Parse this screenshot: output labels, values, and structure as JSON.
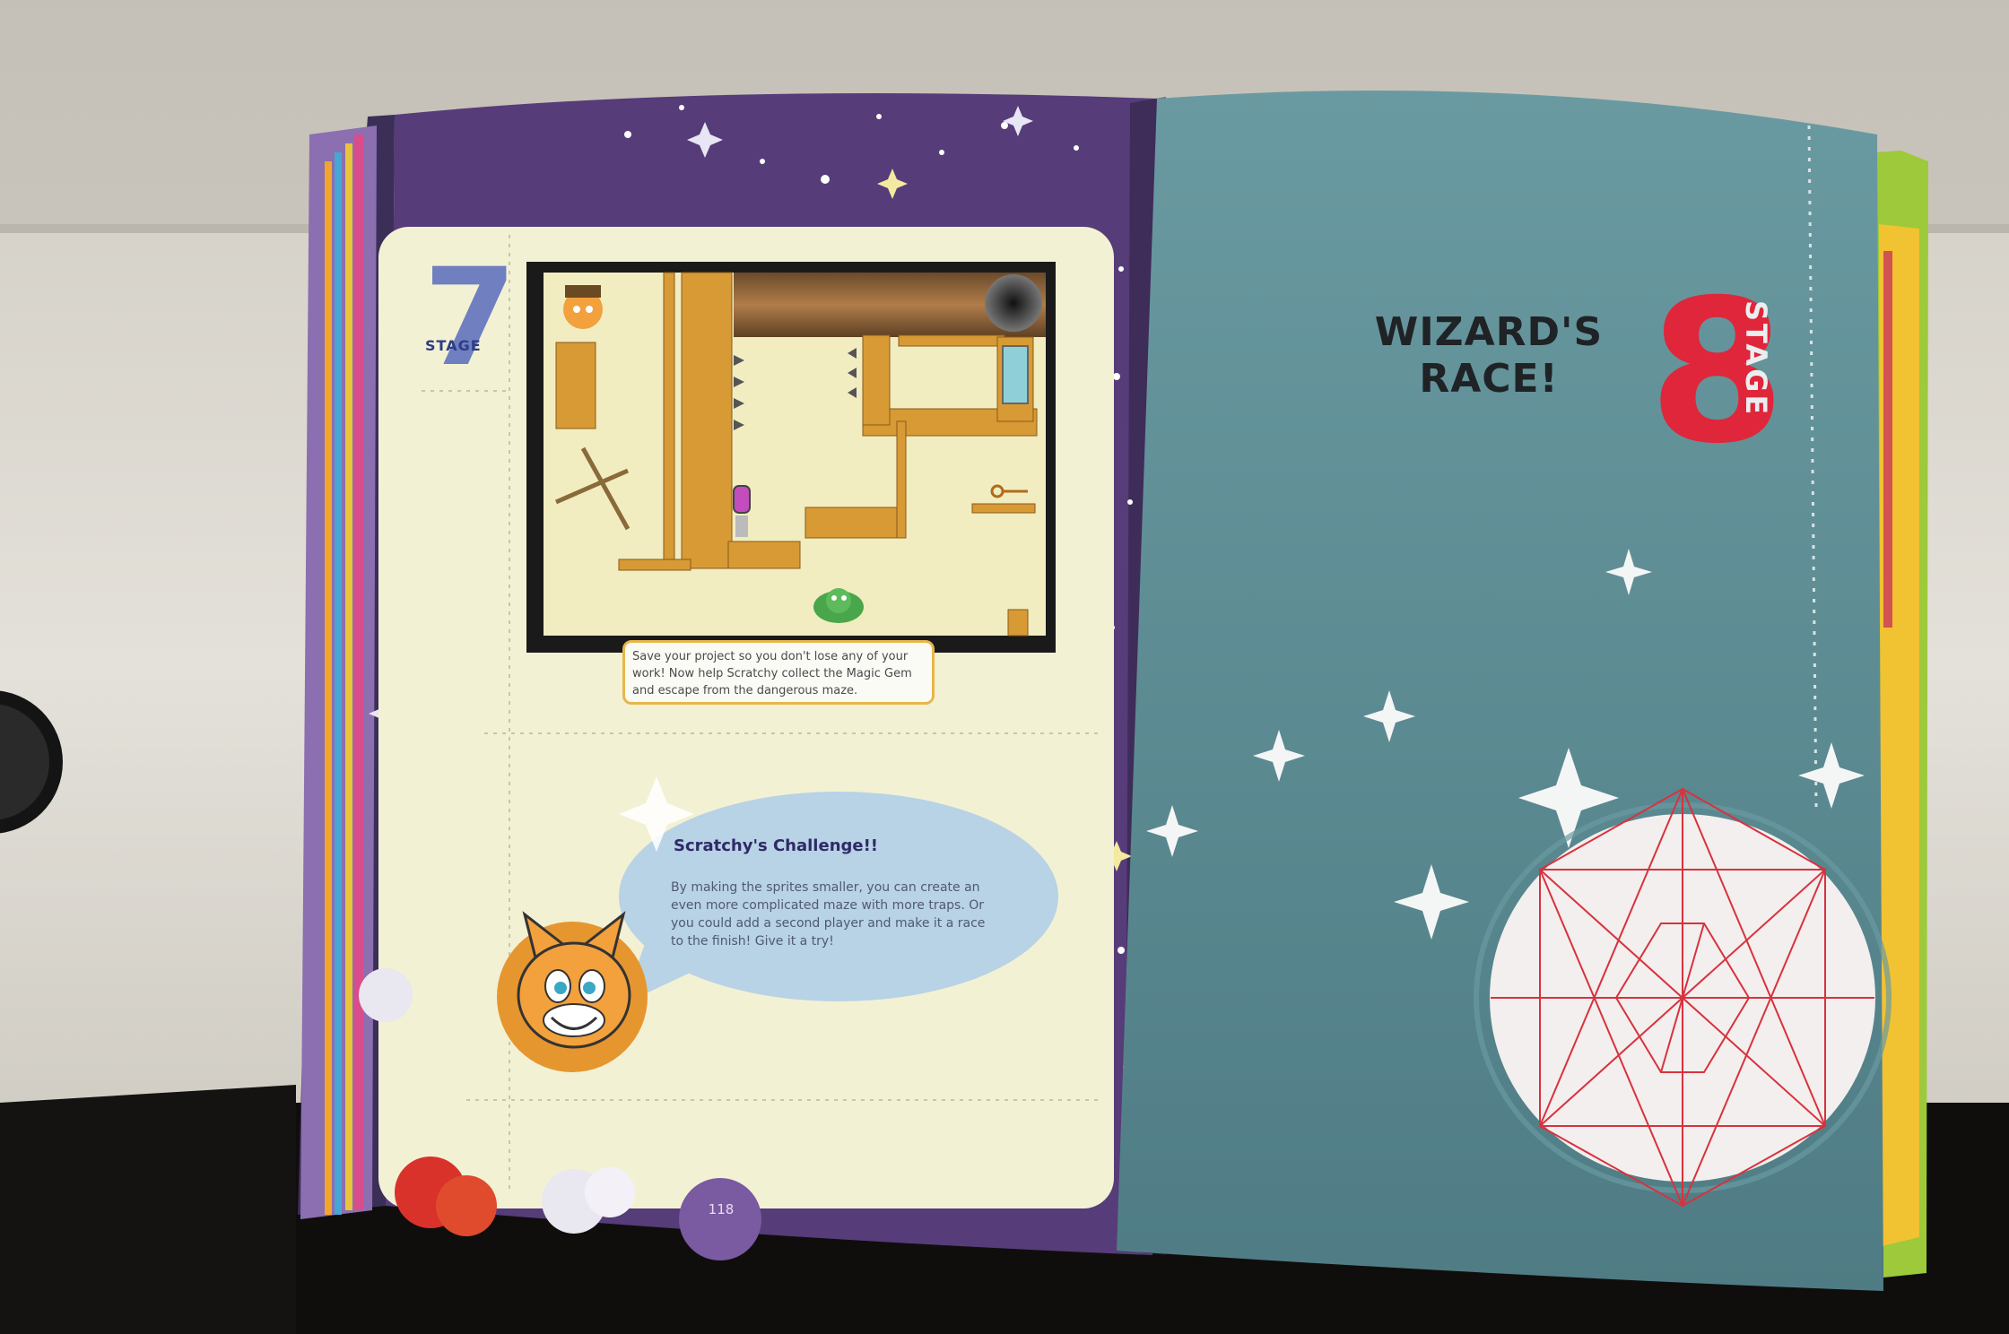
{
  "left_page": {
    "stage_number": "7",
    "stage_word": "STAGE",
    "caption_lines": [
      "Save your project so you don't lose any of your",
      "work! Now help Scratchy collect the Magic Gem",
      "and escape from the dangerous maze."
    ],
    "challenge": {
      "title": "Scratchy's Challenge!!",
      "lines": [
        "By making the sprites smaller, you can create an",
        "even more complicated maze with more traps. Or",
        "you could add a second player and make it a race",
        "to the finish! Give it a try!"
      ]
    },
    "page_number": "118"
  },
  "right_page": {
    "title_lines": [
      "WIZARD'S",
      "RACE!"
    ],
    "stage_number": "8",
    "stage_word": "STAGE"
  },
  "colors": {
    "left_page_purple": "#563c78",
    "panel_cream": "#f3f1d4",
    "right_page_teal": "#5d8a92",
    "stage8_red": "#e0263a",
    "stage7_blue": "#6f7fc0",
    "table_white": "#d9d6cf"
  }
}
